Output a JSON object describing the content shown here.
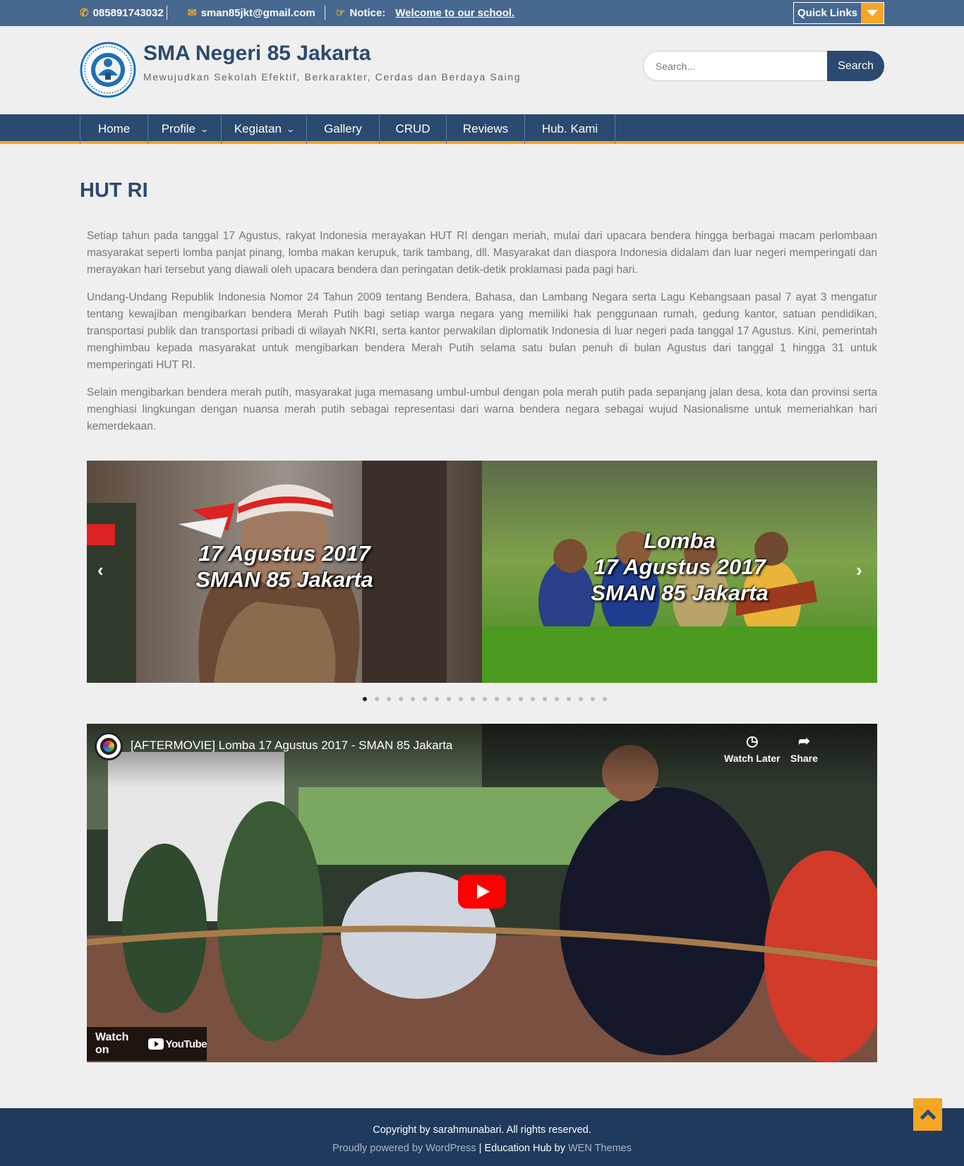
{
  "topbar": {
    "phone": "085891743032",
    "email": "sman85jkt@gmail.com",
    "notice_label": "Notice:",
    "notice_text": "Welcome to our school.",
    "quick_links": "Quick Links"
  },
  "header": {
    "site_title": "SMA Negeri 85 Jakarta",
    "tagline": "Mewujudkan Sekolah Efektif, Berkarakter, Cerdas dan Berdaya Saing",
    "search_placeholder": "Search...",
    "search_button": "Search"
  },
  "nav": {
    "items": [
      {
        "label": "Home"
      },
      {
        "label": "Profile"
      },
      {
        "label": "Kegiatan"
      },
      {
        "label": "Gallery"
      },
      {
        "label": "CRUD"
      },
      {
        "label": "Reviews"
      },
      {
        "label": "Hub. Kami"
      }
    ]
  },
  "page": {
    "title": "HUT RI",
    "paragraphs": [
      "Setiap tahun pada tanggal 17 Agustus, rakyat Indonesia merayakan HUT RI dengan meriah, mulai dari upacara bendera hingga berbagai macam perlombaan masyarakat seperti lomba panjat pinang, lomba makan kerupuk, tarik tambang, dll. Masyarakat dan diaspora Indonesia didalam dan luar negeri memperingati dan merayakan hari tersebut yang diawali oleh upacara bendera dan peringatan detik-detik proklamasi pada pagi hari.",
      "Undang-Undang Republik Indonesia Nomor 24 Tahun 2009 tentang Bendera, Bahasa, dan Lambang Negara serta Lagu Kebangsaan pasal 7 ayat 3 mengatur tentang kewajiban mengibarkan bendera Merah Putih bagi setiap warga negara yang memiliki hak penggunaan rumah, gedung kantor, satuan pendidikan, transportasi publik dan transportasi pribadi di wilayah NKRI, serta kantor perwakilan diplomatik Indonesia di luar negeri pada tanggal 17 Agustus. Kini, pemerintah menghimbau kepada masyarakat untuk mengibarkan bendera Merah Putih selama satu bulan penuh di bulan Agustus dari tanggal 1 hingga 31 untuk memperingati HUT RI.",
      "Selain mengibarkan bendera merah putih, masyarakat juga memasang umbul-umbul dengan pola merah putih pada sepanjang jalan desa, kota dan provinsi serta menghiasi lingkungan dengan nuansa merah putih sebagai representasi dari warna bendera negara sebagai wujud Nasionalisme untuk memeriahkan hari kemerdekaan."
    ]
  },
  "slider": {
    "slides": [
      {
        "line1": "17 Agustus 2017",
        "line2": "SMAN 85 Jakarta"
      },
      {
        "line1": "Lomba",
        "line2": "17 Agustus 2017",
        "line3": "SMAN 85 Jakarta"
      }
    ],
    "dot_count": 21,
    "active_dot": 0
  },
  "video": {
    "title": "[AFTERMOVIE] Lomba 17 Agustus 2017 - SMAN 85 Jakarta",
    "watch_later": "Watch Later",
    "share": "Share",
    "watch_on": "Watch on",
    "youtube": "YouTube"
  },
  "footer": {
    "copyright": "Copyright by sarahmunabari. All rights reserved.",
    "powered": "Proudly powered by WordPress",
    "separator": "|",
    "theme_name": "Education Hub",
    "by": "by",
    "theme_author": "WEN Themes"
  },
  "colors": {
    "primary": "#2b4a6f",
    "topbar": "#47688f",
    "accent": "#f5a623",
    "footer": "#1f3a5c"
  },
  "icons": {
    "phone": "phone-icon",
    "email": "envelope-icon",
    "notice": "hand-point-icon",
    "quick_links": "caret-down-icon",
    "back_to_top": "chevron-up-icon"
  }
}
